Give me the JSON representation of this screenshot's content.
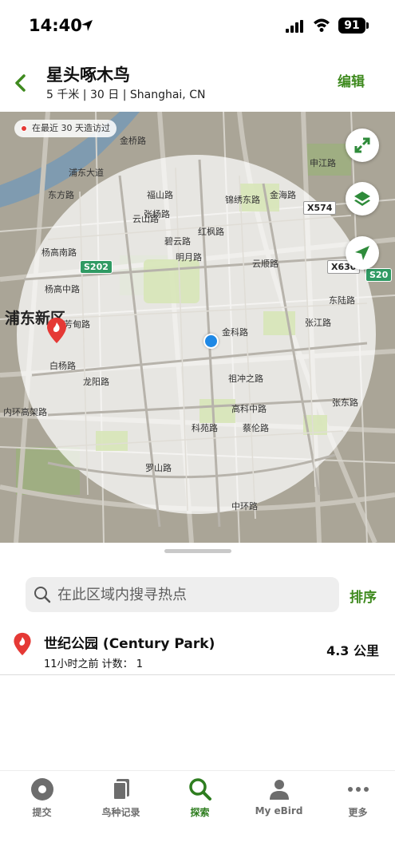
{
  "status_bar": {
    "time": "14:40",
    "battery": "91"
  },
  "header": {
    "title": "星头啄木鸟",
    "subtitle": "5 千米 | 30 日 | Shanghai, CN",
    "edit_label": "编辑"
  },
  "map": {
    "recent_chip": "在最近 30 天造访过",
    "district_label": "浦东新区",
    "highway_badges": [
      "S202",
      "S20"
    ],
    "road_badges": [
      "X574",
      "X630"
    ],
    "street_labels": [
      "杨高南路",
      "杨高中路",
      "浦东大道",
      "东方路",
      "张杨路",
      "福山路",
      "芳甸路",
      "白杨路",
      "龙阳路",
      "内环高架路",
      "罗山路",
      "中环路",
      "科苑路",
      "蔡伦路",
      "高科中路",
      "祖冲之路",
      "金科路",
      "云山路",
      "明月路",
      "碧云路",
      "金桥路",
      "红枫路",
      "云顺路",
      "锦绣东路",
      "申江路",
      "张东路",
      "张江路",
      "金海路",
      "东陆路"
    ],
    "icons": [
      "expand-icon",
      "layers-icon",
      "locate-icon"
    ]
  },
  "search": {
    "placeholder": "在此区域内搜寻热点",
    "sort_label": "排序"
  },
  "hotspots": [
    {
      "name": "世纪公园 (Century Park)",
      "meta": "11小时之前 计数： 1",
      "distance": "4.3 公里"
    }
  ],
  "tabs": [
    {
      "label": "提交",
      "icon": "submit-icon",
      "active": false
    },
    {
      "label": "鸟种记录",
      "icon": "species-list-icon",
      "active": false
    },
    {
      "label": "探索",
      "icon": "search-icon",
      "active": true
    },
    {
      "label": "My eBird",
      "icon": "person-icon",
      "active": false
    },
    {
      "label": "更多",
      "icon": "more-icon",
      "active": false
    }
  ],
  "colors": {
    "accent": "#3f8a1f",
    "user_location": "#1e88e5",
    "hotspot": "#e53935",
    "highway": "#2f9a63"
  }
}
